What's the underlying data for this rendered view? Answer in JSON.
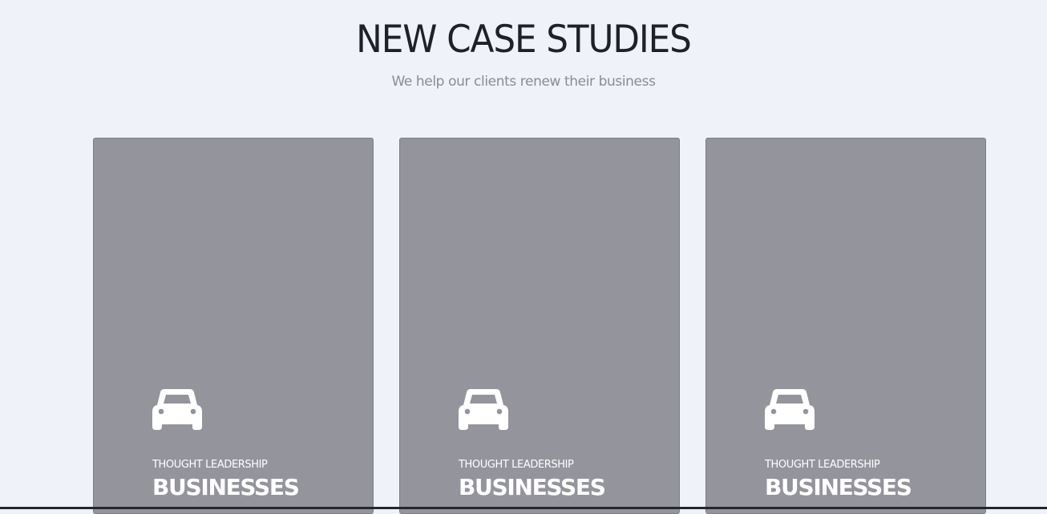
{
  "section": {
    "title": "NEW CASE STUDIES",
    "subtitle": "We help our clients renew their business"
  },
  "cards": [
    {
      "icon": "car-icon",
      "category": "THOUGHT LEADERSHIP",
      "title": "BUSINESSES"
    },
    {
      "icon": "car-icon",
      "category": "THOUGHT LEADERSHIP",
      "title": "BUSINESSES"
    },
    {
      "icon": "car-icon",
      "category": "THOUGHT LEADERSHIP",
      "title": "BUSINESSES"
    }
  ],
  "colors": {
    "page_background": "#eff2f8",
    "card_background": "#94949d",
    "title_text": "#1f2128",
    "subtitle_text": "#8a8c96",
    "card_text": "#ffffff"
  }
}
